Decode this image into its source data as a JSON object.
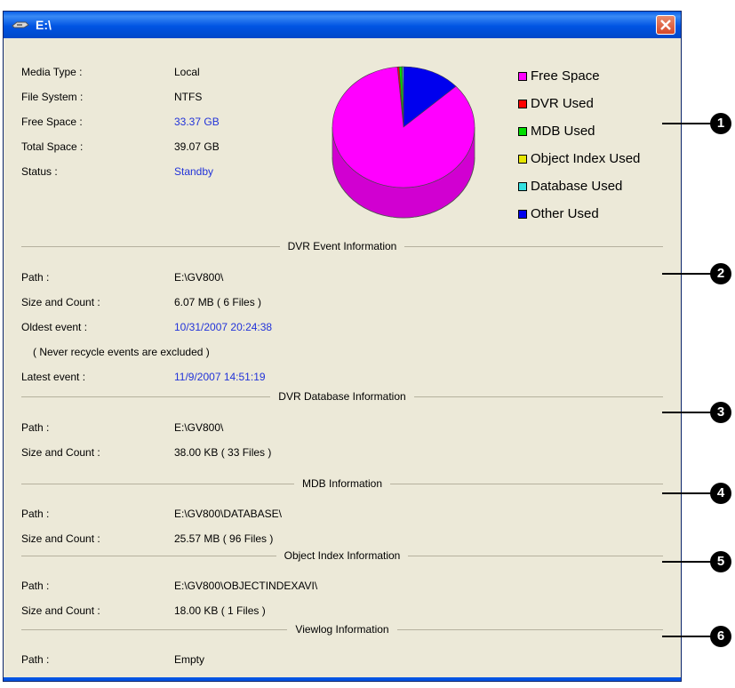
{
  "window": {
    "title": "E:\\"
  },
  "summary": [
    {
      "label": "Media Type :",
      "value": "Local"
    },
    {
      "label": "File System :",
      "value": "NTFS"
    },
    {
      "label": "Free Space :",
      "value": "33.37 GB"
    },
    {
      "label": "Total Space :",
      "value": "39.07 GB"
    },
    {
      "label": "Status :",
      "value": "Standby"
    }
  ],
  "legend": [
    {
      "label": "Free Space",
      "color": "#ff00ff"
    },
    {
      "label": "DVR Used",
      "color": "#ff0000"
    },
    {
      "label": "MDB Used",
      "color": "#00dd00"
    },
    {
      "label": "Object Index Used",
      "color": "#e6e600"
    },
    {
      "label": "Database Used",
      "color": "#33e0e0"
    },
    {
      "label": "Other Used",
      "color": "#0000ee"
    }
  ],
  "chart_data": {
    "type": "pie",
    "labels": [
      "Free Space",
      "DVR Used",
      "MDB Used",
      "Object Index Used",
      "Database Used",
      "Other Used"
    ],
    "values": [
      33.37,
      0.15,
      0.25,
      0.02,
      0.12,
      5.16
    ],
    "unit": "GB",
    "legend_position": "right"
  },
  "sections": {
    "dvr_event": {
      "title": "DVR Event Information",
      "path_label": "Path :",
      "path": "E:\\GV800\\",
      "size_label": "Size and Count :",
      "size": "6.07 MB ( 6 Files )",
      "oldest_label": "Oldest event :",
      "oldest": "10/31/2007 20:24:38",
      "note": "( Never recycle events are excluded )",
      "latest_label": "Latest event :",
      "latest": "11/9/2007 14:51:19"
    },
    "dvr_database": {
      "title": "DVR Database Information",
      "path_label": "Path :",
      "path": "E:\\GV800\\",
      "size_label": "Size and Count :",
      "size": "38.00 KB ( 33 Files )"
    },
    "mdb": {
      "title": "MDB Information",
      "path_label": "Path :",
      "path": "E:\\GV800\\DATABASE\\",
      "size_label": "Size and Count :",
      "size": "25.57 MB ( 96 Files )"
    },
    "object_index": {
      "title": "Object Index Information",
      "path_label": "Path :",
      "path": "E:\\GV800\\OBJECTINDEXAVI\\",
      "size_label": "Size and Count :",
      "size": "18.00 KB ( 1 Files )"
    },
    "viewlog": {
      "title": "Viewlog Information",
      "path_label": "Path :",
      "path": "Empty"
    }
  },
  "callouts": [
    "1",
    "2",
    "3",
    "4",
    "5",
    "6"
  ]
}
